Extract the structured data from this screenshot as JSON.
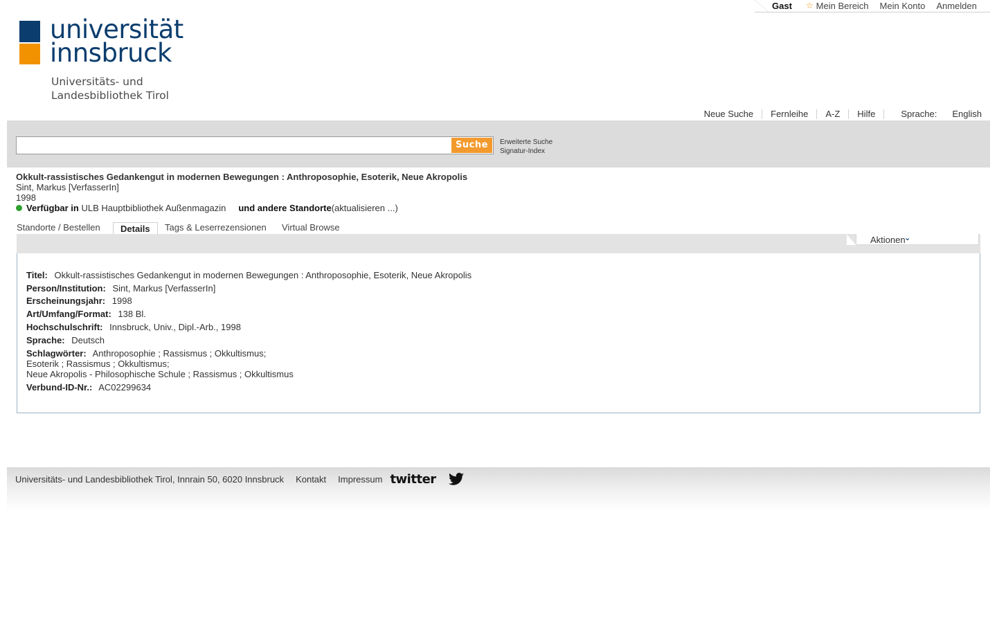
{
  "userbar": {
    "guest": "Gast",
    "items": [
      "Mein Bereich",
      "Mein Konto",
      "Anmelden"
    ]
  },
  "logo": {
    "line1": "universität",
    "line2": "innsbruck",
    "sub1": "Universitäts- und",
    "sub2": "Landesbibliothek Tirol",
    "colors": {
      "blue": "#0b3d6e",
      "orange": "#f39200"
    }
  },
  "nav": {
    "items": [
      "Neue Suche",
      "Fernleihe",
      "A-Z",
      "Hilfe"
    ],
    "language_label": "Sprache:",
    "language": "English"
  },
  "search": {
    "value": "",
    "button": "Suche",
    "links": [
      "Erweiterte Suche",
      "Signatur-Index"
    ]
  },
  "record": {
    "title": "Okkult-rassistisches Gedankengut in modernen Bewegungen : Anthroposophie, Esoterik, Neue Akropolis",
    "author": "Sint, Markus [VerfasserIn]",
    "year": "1998",
    "available_label": "Verfügbar in",
    "location": "ULB Hauptbibliothek Außenmagazin",
    "other_locations": "und andere Standorte",
    "refresh": "(aktualisieren ...)"
  },
  "tabs": [
    {
      "label": "Standorte / Bestellen",
      "active": false
    },
    {
      "label": "Details",
      "active": true
    },
    {
      "label": "Tags & Leserrezensionen",
      "active": false
    },
    {
      "label": "Virtual Browse",
      "active": false
    }
  ],
  "actions": {
    "label": "Aktionen"
  },
  "details": {
    "title_k": "Titel:",
    "title_v": "Okkult-rassistisches Gedankengut in modernen Bewegungen : Anthroposophie, Esoterik, Neue Akropolis",
    "person_k": "Person/Institution:",
    "person_v": "Sint, Markus [VerfasserIn]",
    "year_k": "Erscheinungsjahr:",
    "year_v": "1998",
    "format_k": "Art/Umfang/Format:",
    "format_v": "138 Bl.",
    "thesis_k": "Hochschulschrift:",
    "thesis_v": "Innsbruck, Univ., Dipl.-Arb., 1998",
    "lang_k": "Sprache:",
    "lang_v": "Deutsch",
    "subjects_k": "Schlagwörter:",
    "subjects": [
      "Anthroposophie ; Rassismus ; Okkultismus;",
      "Esoterik ; Rassismus ; Okkultismus;",
      "Neue Akropolis - Philosophische Schule ; Rassismus ; Okkultismus"
    ],
    "id_k": "Verbund-ID-Nr.:",
    "id_v": "AC02299634"
  },
  "footer": {
    "address": "Universitäts- und Landesbibliothek Tirol, Innrain 50, 6020 Innsbruck",
    "contact": "Kontakt",
    "imprint": "Impressum",
    "twitter": "twitter"
  }
}
